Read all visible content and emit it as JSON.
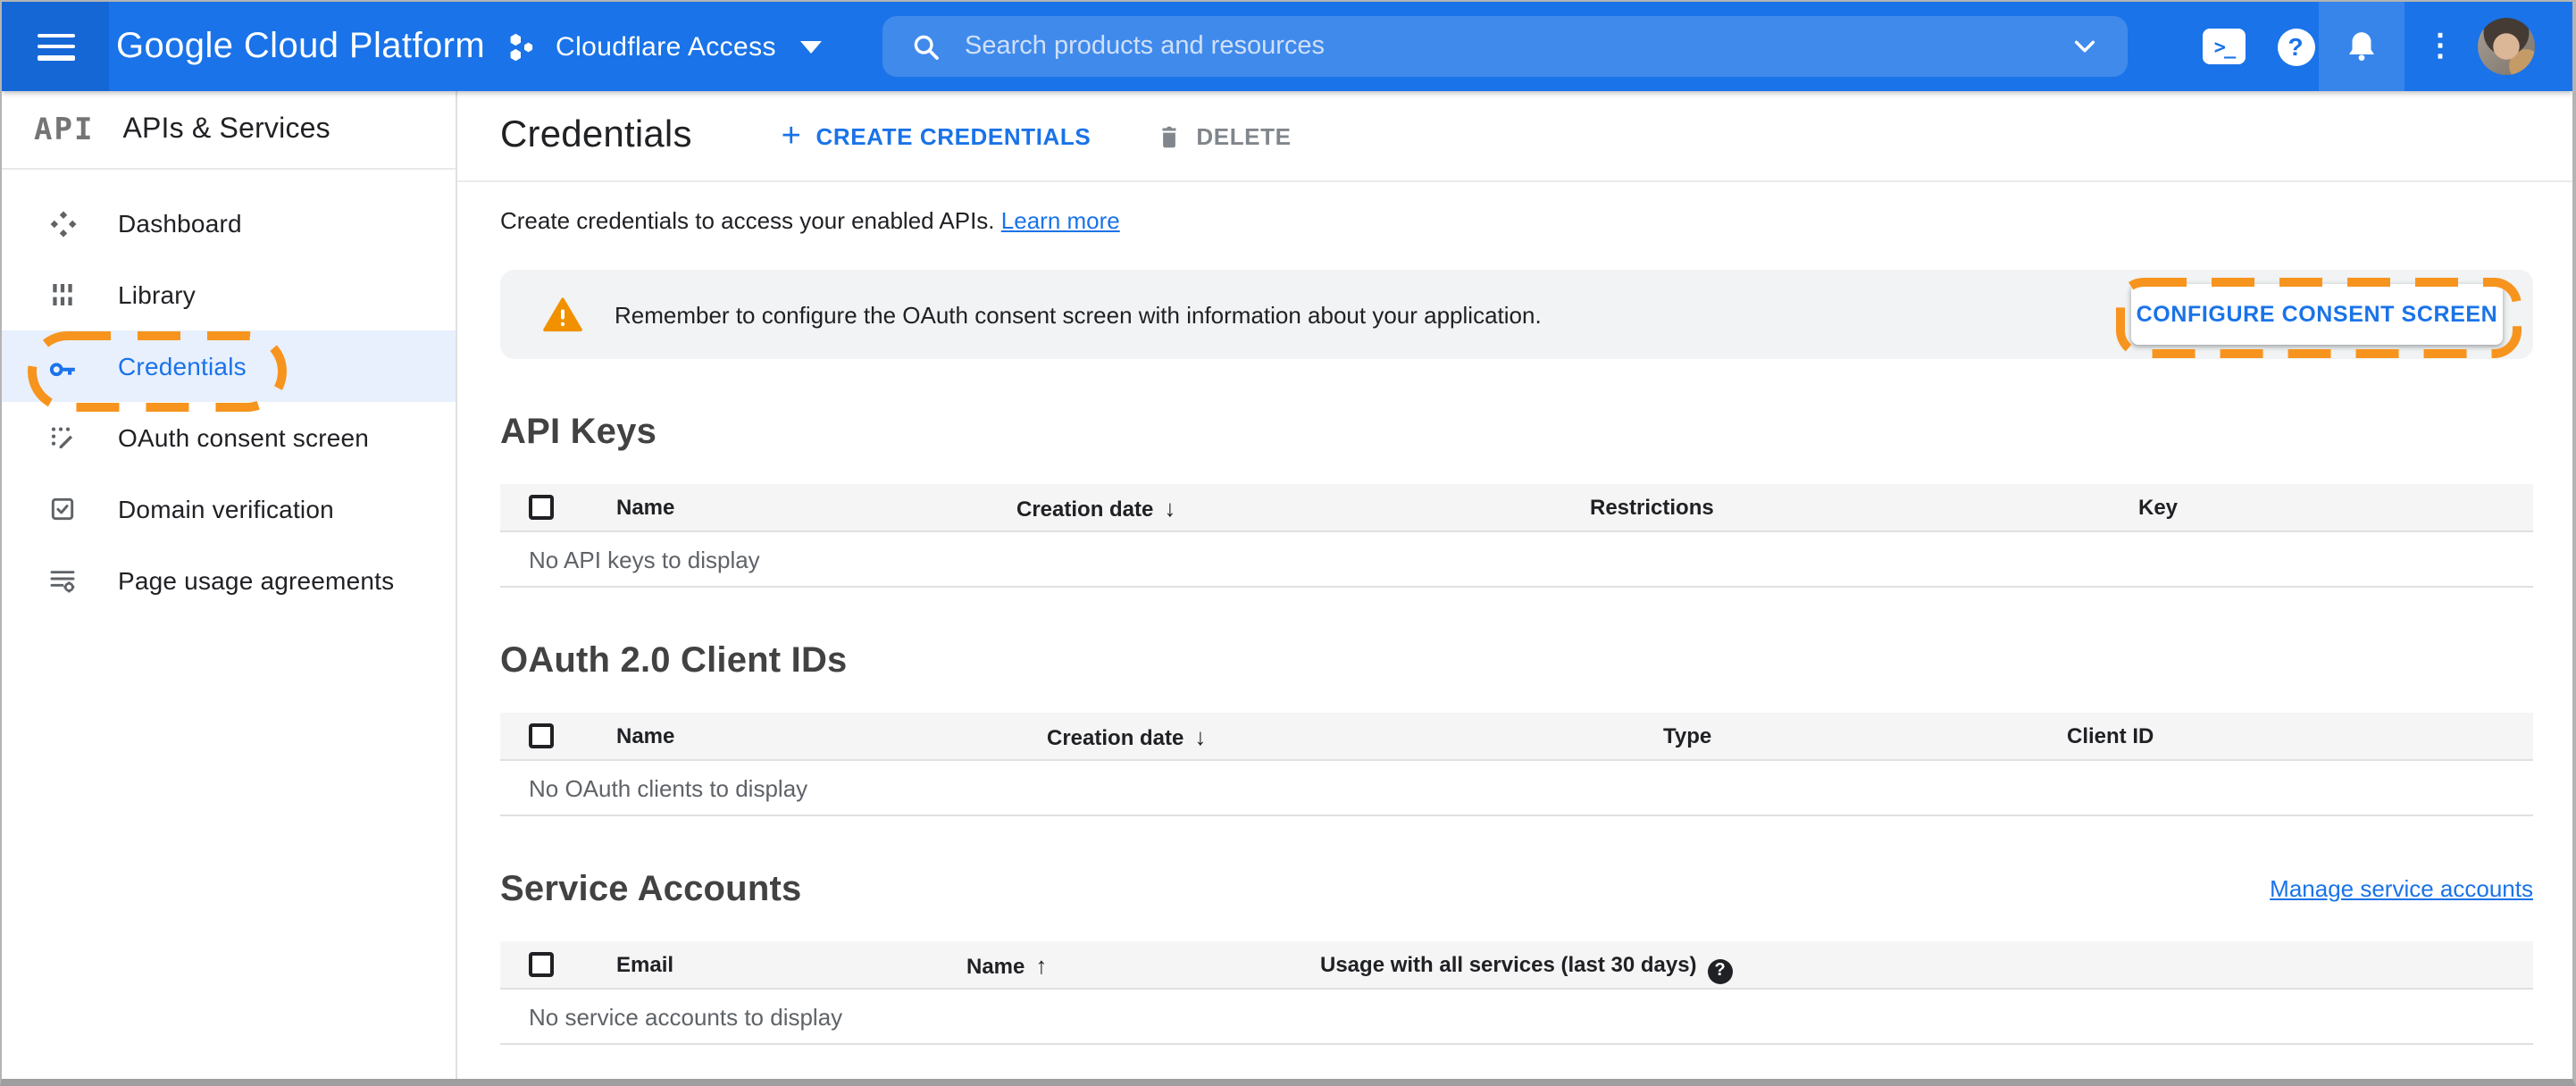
{
  "topbar": {
    "product_name": "Google Cloud Platform",
    "project_name": "Cloudflare Access",
    "search_placeholder": "Search products and resources"
  },
  "sidebar": {
    "logo_text": "API",
    "title": "APIs & Services",
    "items": [
      {
        "label": "Dashboard"
      },
      {
        "label": "Library"
      },
      {
        "label": "Credentials",
        "active": true,
        "annotated": true
      },
      {
        "label": "OAuth consent screen"
      },
      {
        "label": "Domain verification"
      },
      {
        "label": "Page usage agreements"
      }
    ]
  },
  "header": {
    "title": "Credentials",
    "create_label": "CREATE CREDENTIALS",
    "delete_label": "DELETE"
  },
  "intro": {
    "text": "Create credentials to access your enabled APIs. ",
    "link_label": "Learn more"
  },
  "banner": {
    "message": "Remember to configure the OAuth consent screen with information about your application.",
    "button_label": "CONFIGURE CONSENT SCREEN"
  },
  "api_keys": {
    "title": "API Keys",
    "columns": {
      "name": "Name",
      "creation_date": "Creation date",
      "restrictions": "Restrictions",
      "key": "Key"
    },
    "sort_column": "Creation date",
    "sort_direction": "desc",
    "empty": "No API keys to display"
  },
  "oauth_clients": {
    "title": "OAuth 2.0 Client IDs",
    "columns": {
      "name": "Name",
      "creation_date": "Creation date",
      "type": "Type",
      "client_id": "Client ID"
    },
    "sort_column": "Creation date",
    "sort_direction": "desc",
    "empty": "No OAuth clients to display"
  },
  "service_accounts": {
    "title": "Service Accounts",
    "manage_link": "Manage service accounts",
    "columns": {
      "email": "Email",
      "name": "Name",
      "usage": "Usage with all services (last 30 days)"
    },
    "sort_column": "Name",
    "sort_direction": "asc",
    "empty": "No service accounts to display"
  },
  "icons": {
    "plus": "+",
    "shell_prompt": ">_",
    "question": "?",
    "ellipsis": "⋮",
    "sort_desc": "↓",
    "sort_asc": "↑",
    "help": "?"
  },
  "colors": {
    "topbar_blue": "#1a73e8",
    "accent_blue": "#1a73e8",
    "active_item_bg": "#e8f0fe",
    "annotation_orange": "#f7941e",
    "warning_orange": "#f29100",
    "banner_bg": "#f1f3f4"
  }
}
